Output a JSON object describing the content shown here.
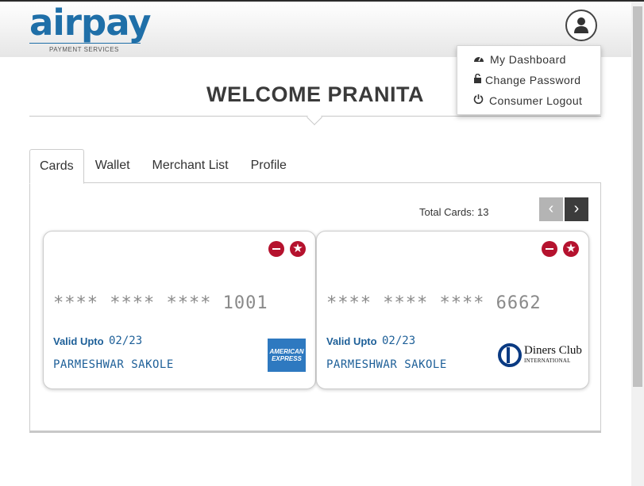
{
  "brand": {
    "name": "airpay",
    "tagline": "PAYMENT SERVICES",
    "color": "#1f6fa8"
  },
  "user_menu": {
    "icon": "user-avatar-icon",
    "items": [
      {
        "icon": "dashboard-icon",
        "label": "My Dashboard"
      },
      {
        "icon": "lock-icon",
        "label": "Change Password"
      },
      {
        "icon": "power-icon",
        "label": "Consumer Logout"
      }
    ]
  },
  "welcome": "WELCOME PRANITA",
  "tabs": [
    {
      "label": "Cards",
      "active": true
    },
    {
      "label": "Wallet",
      "active": false
    },
    {
      "label": "Merchant List",
      "active": false
    },
    {
      "label": "Profile",
      "active": false
    }
  ],
  "cards_panel": {
    "total_label": "Total Cards: 13",
    "prev_icon": "chevron-left-icon",
    "next_icon": "chevron-right-icon"
  },
  "cards": [
    {
      "number": "**** **** **** 1001",
      "valid_label": "Valid Upto",
      "valid_value": "02/23",
      "holder": "PARMESHWAR SAKOLE",
      "network": "American Express",
      "network_logo_lines": [
        "AMERICAN",
        "EXPRESS"
      ]
    },
    {
      "number": "**** **** **** 6662",
      "valid_label": "Valid Upto",
      "valid_value": "02/23",
      "holder": "PARMESHWAR SAKOLE",
      "network": "Diners Club",
      "network_logo_lines": [
        "Diners Club",
        "INTERNATIONAL"
      ]
    }
  ],
  "colors": {
    "accent_red": "#b5122e",
    "text_blue": "#1d5f98"
  }
}
